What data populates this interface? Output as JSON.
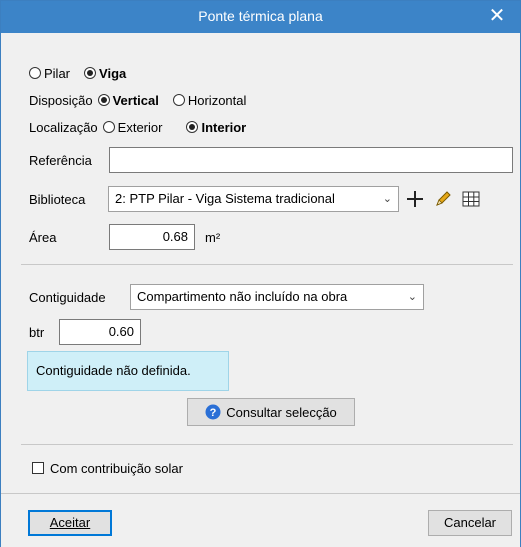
{
  "window": {
    "title": "Ponte térmica plana",
    "close_glyph": "✕"
  },
  "tipo": {
    "option1": "Pilar",
    "option2": "Viga",
    "selected": "Viga"
  },
  "disposicao": {
    "label": "Disposição",
    "option1": "Vertical",
    "option2": "Horizontal",
    "selected": "Vertical"
  },
  "localizacao": {
    "label": "Localização",
    "option1": "Exterior",
    "option2": "Interior",
    "selected": "Interior"
  },
  "referencia": {
    "label": "Referência",
    "value": ""
  },
  "biblioteca": {
    "label": "Biblioteca",
    "value": "2: PTP Pilar - Viga Sistema tradicional",
    "icons": [
      "plus-icon",
      "pencil-icon",
      "table-icon"
    ]
  },
  "area": {
    "label": "Área",
    "value": "0.68",
    "unit": "m²"
  },
  "contiguidade": {
    "label": "Contiguidade",
    "value": "Compartimento não incluído na obra"
  },
  "btr": {
    "label": "btr",
    "value": "0.60"
  },
  "info_text": "Contiguidade não definida.",
  "consult_button": "Consultar selecção",
  "solar": {
    "label": "Com contribuição solar",
    "checked": false
  },
  "footer": {
    "accept": "Aceitar",
    "cancel": "Cancelar"
  },
  "colors": {
    "titlebar": "#3c84c8",
    "info_bg": "#cfeff8",
    "help_icon": "#2a6fd6",
    "pencil": "#e6a818"
  }
}
